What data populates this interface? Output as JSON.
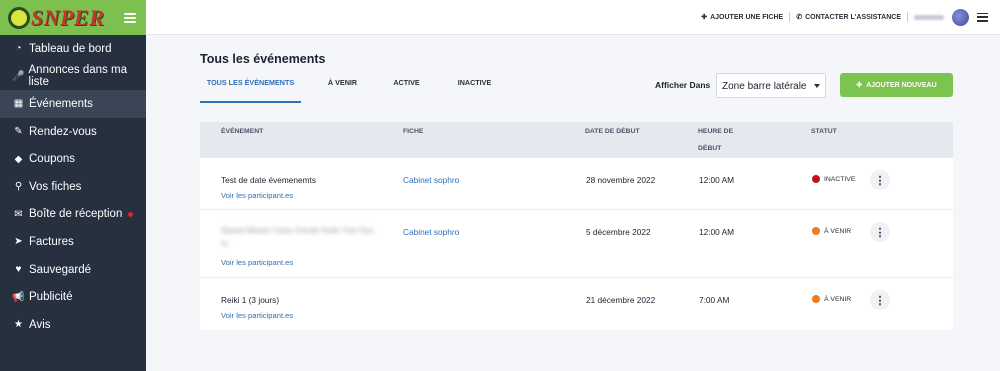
{
  "brand": {
    "logo_text": "SNPER"
  },
  "sidebar": {
    "items": [
      {
        "label": "Tableau de bord",
        "icon": "◔",
        "icon_name": "dashboard-icon"
      },
      {
        "label": "Annonces dans ma liste",
        "icon": "🎤",
        "icon_name": "microphone-icon"
      },
      {
        "label": "Événements",
        "icon": "▦",
        "icon_name": "calendar-icon"
      },
      {
        "label": "Rendez-vous",
        "icon": "✎",
        "icon_name": "edit-icon"
      },
      {
        "label": "Coupons",
        "icon": "◆",
        "icon_name": "tag-icon"
      },
      {
        "label": "Vos fiches",
        "icon": "⚲",
        "icon_name": "map-pin-icon"
      },
      {
        "label": "Boîte de réception",
        "icon": "✉",
        "icon_name": "envelope-icon"
      },
      {
        "label": "Factures",
        "icon": "➤",
        "icon_name": "paper-plane-icon"
      },
      {
        "label": "Sauvegardé",
        "icon": "♥",
        "icon_name": "heart-icon"
      },
      {
        "label": "Publicité",
        "icon": "📢",
        "icon_name": "megaphone-icon"
      },
      {
        "label": "Avis",
        "icon": "★",
        "icon_name": "star-icon"
      }
    ]
  },
  "topbar": {
    "add_listing": "AJOUTER UNE FICHE",
    "contact_support": "CONTACTER L'ASSISTANCE"
  },
  "main": {
    "title": "Tous les événements",
    "tabs": [
      {
        "label": "TOUS LES ÉVÉNEMENTS"
      },
      {
        "label": "À VENIR"
      },
      {
        "label": "ACTIVE"
      },
      {
        "label": "INACTIVE"
      }
    ],
    "filter_label": "Afficher Dans",
    "filter_value": "Zone barre latérale",
    "add_button": "AJOUTER NOUVEAU"
  },
  "table": {
    "headers": {
      "event": "ÉVÉNEMENT",
      "listing": "FICHE",
      "start_date": "DATE DE DÉBUT",
      "start_time_line1": "HEURE DE",
      "start_time_line2": "DÉBUT",
      "status": "STATUT"
    },
    "rows": [
      {
        "event": "Test de date évemenemts",
        "participants": "Voir les participant.es",
        "listing": "Cabinet sophro",
        "date": "28 novembre 2022",
        "time": "12:00 AM",
        "status": "INACTIVE",
        "status_color": "#c0131e"
      },
      {
        "event_blurred_line1": "Speed Master Class Gerale Reiki Yuto Nyo",
        "event_blurred_line2": "to",
        "participants": "Voir les participant.es",
        "listing": "Cabinet sophro",
        "date": "5 décembre 2022",
        "time": "12:00 AM",
        "status": "À VENIR",
        "status_color": "#f07a1a"
      },
      {
        "event": "Reiki 1 (3 jours)",
        "participants": "Voir les participant.es",
        "listing": "",
        "date": "21 décembre 2022",
        "time": "7:00 AM",
        "status": "À VENIR",
        "status_color": "#f07a1a"
      }
    ]
  }
}
